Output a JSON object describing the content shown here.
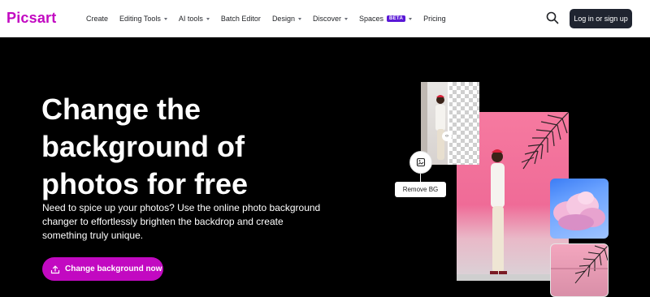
{
  "brand": {
    "logo_text": "Picsart",
    "accent": "#c209c1"
  },
  "nav": {
    "items": [
      {
        "label": "Create",
        "caret": false
      },
      {
        "label": "Editing Tools",
        "caret": true
      },
      {
        "label": "AI tools",
        "caret": true
      },
      {
        "label": "Batch Editor",
        "caret": false
      },
      {
        "label": "Design",
        "caret": true
      },
      {
        "label": "Discover",
        "caret": true
      },
      {
        "label": "Spaces",
        "caret": true,
        "badge": "BETA"
      },
      {
        "label": "Pricing",
        "caret": false
      }
    ],
    "search_icon": "search-icon",
    "login_label": "Log in or sign up"
  },
  "hero": {
    "title_lines": [
      "Change the",
      "background of",
      "photos for free"
    ],
    "description_lines": [
      "Need to spice up your photos? Use the online photo background",
      "changer to effortlessly brighten the backdrop and create",
      "something truly unique."
    ],
    "cta_label": "Change background now",
    "cta_icon": "upload-icon"
  },
  "collage": {
    "remove_bg_label": "Remove BG",
    "remove_bg_icon": "remove-bg-icon",
    "divider_handle_icon": "compare-handle-icon"
  }
}
